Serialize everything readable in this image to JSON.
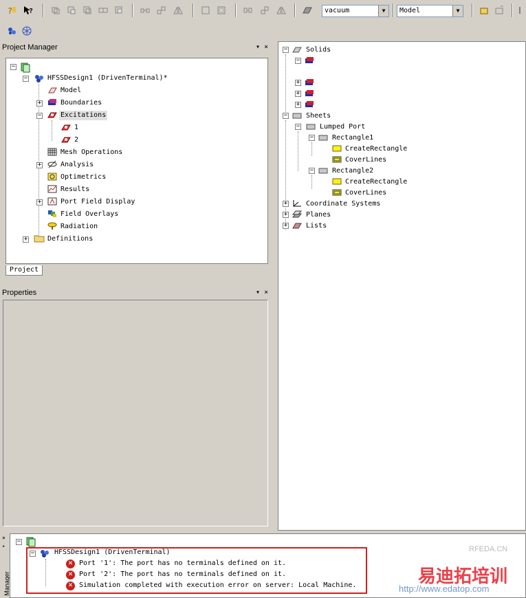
{
  "toolbar": {
    "material_combo": "vacuum",
    "view_combo": "Model"
  },
  "project_manager": {
    "title": "Project Manager",
    "close": "×",
    "design": "HFSSDesign1 (DrivenTerminal)*",
    "items": {
      "model": "Model",
      "boundaries": "Boundaries",
      "excitations": "Excitations",
      "port1": "1",
      "port2": "2",
      "mesh": "Mesh Operations",
      "analysis": "Analysis",
      "optimetrics": "Optimetrics",
      "results": "Results",
      "port_field": "Port Field Display",
      "field_overlays": "Field Overlays",
      "radiation": "Radiation",
      "definitions": "Definitions"
    },
    "tab": "Project"
  },
  "properties": {
    "title": "Properties",
    "close": "×"
  },
  "model_tree": {
    "solids": "Solids",
    "sheets": "Sheets",
    "lumped_port": "Lumped Port",
    "rect1": "Rectangle1",
    "create_rect1": "CreateRectangle",
    "cover1": "CoverLines",
    "rect2": "Rectangle2",
    "create_rect2": "CreateRectangle",
    "cover2": "CoverLines",
    "coord": "Coordinate Systems",
    "planes": "Planes",
    "lists": "Lists"
  },
  "messages": {
    "side_label": "Manager",
    "design": "HFSSDesign1 (DrivenTerminal)",
    "errors": [
      "Port '1': The port has no terminals defined on it.",
      "Port '2': The port has no terminals defined on it.",
      "Simulation completed with execution error on server: Local Machine."
    ]
  },
  "watermark": {
    "brand": "RFEDA.CN",
    "cn_text": "易迪拓培训",
    "url": "http://www.edatop.com"
  },
  "colors": {
    "error": "#c8201a",
    "highlight_box": "#d02020",
    "watermark": "#e8212a"
  }
}
